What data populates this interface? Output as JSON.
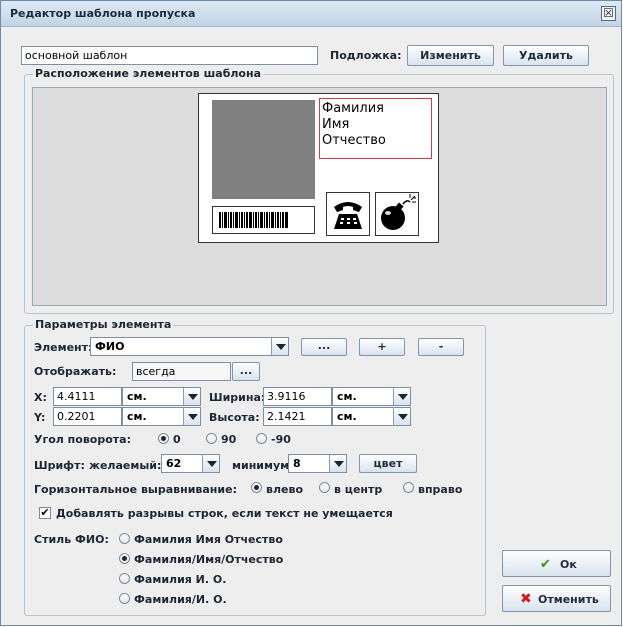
{
  "window": {
    "title": "Редактор шаблона пропуска",
    "close_glyph": "☒"
  },
  "template_name": {
    "value": "основной шаблон"
  },
  "background": {
    "label": "Подложка:",
    "change_button": "Изменить",
    "delete_button": "Удалить"
  },
  "layout_group": {
    "legend": "Расположение элементов шаблона",
    "card": {
      "name_lines": [
        "Фамилия",
        "Имя",
        "Отчество"
      ]
    }
  },
  "params_group": {
    "legend": "Параметры элемента",
    "element_label": "Элемент:",
    "element_value": "ФИО",
    "btn_more": "...",
    "btn_add": "+",
    "btn_remove": "-",
    "display_label": "Отображать:",
    "display_value": "всегда",
    "display_btn": "...",
    "x_label": "X:",
    "x_value": "4.4111",
    "x_unit": "см.",
    "y_label": "Y:",
    "y_value": "0.2201",
    "y_unit": "см.",
    "width_label": "Ширина:",
    "width_value": "3.9116",
    "width_unit": "см.",
    "height_label": "Высота:",
    "height_value": "2.1421",
    "height_unit": "см.",
    "rotation_label": "Угол поворота:",
    "rotation_options": [
      "0",
      "90",
      "-90"
    ],
    "rotation_selected": "0",
    "font_label": "Шрифт:",
    "font_desired_label": "желаемый:",
    "font_desired_value": "62",
    "font_min_label": "минимум:",
    "font_min_value": "8",
    "color_button": "цвет",
    "halign_label": "Горизонтальное выравнивание:",
    "halign_options": [
      "влево",
      "в центр",
      "вправо"
    ],
    "halign_selected": "влево",
    "wrap_checkbox": "Добавлять разрывы строк, если текст не умещается",
    "wrap_checked": true,
    "fio_style_label": "Стиль ФИО:",
    "fio_style_options": [
      "Фамилия Имя Отчество",
      "Фамилия/Имя/Отчество",
      "Фамилия И. О.",
      "Фамилия/И. О."
    ],
    "fio_style_selected": "Фамилия/Имя/Отчество"
  },
  "buttons": {
    "ok": "Ок",
    "cancel": "Отменить"
  },
  "colors": {
    "accent_red": "#d01c1c",
    "title_bar": "#c3d3e6",
    "frame_red": "#d23a4a"
  }
}
